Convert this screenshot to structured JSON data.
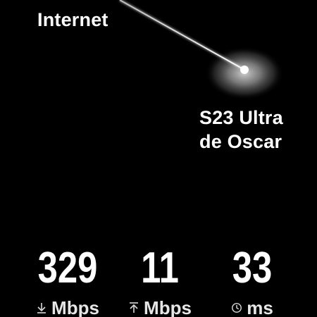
{
  "colors": {
    "background": "#000000",
    "text": "#ffffff",
    "beam": "#ffffff",
    "glow": "#8a8a8a"
  },
  "connection": {
    "source_label": "Internet",
    "device_label_line1": "S23 Ultra",
    "device_label_line2": "de Oscar"
  },
  "metrics": {
    "download": {
      "value": "329",
      "unit": "Mbps",
      "icon": "download-arrow-icon"
    },
    "upload": {
      "value": "11",
      "unit": "Mbps",
      "icon": "upload-arrow-icon"
    },
    "ping": {
      "value": "33",
      "unit": "ms",
      "icon": "clock-icon"
    }
  }
}
